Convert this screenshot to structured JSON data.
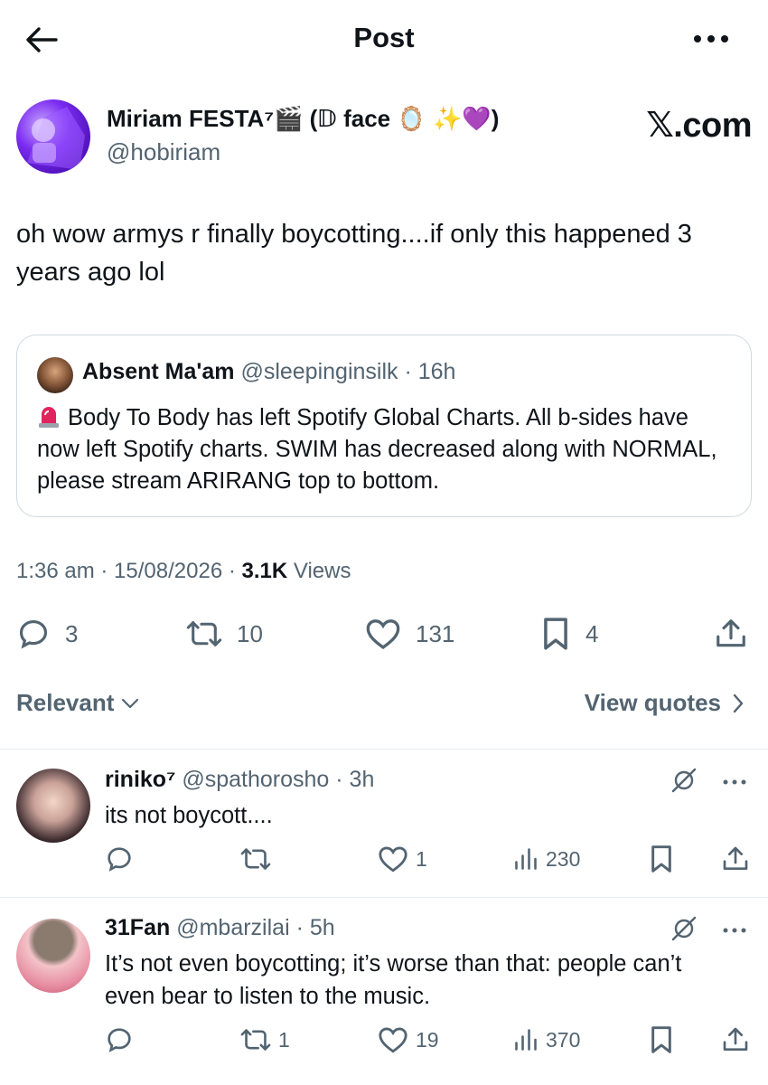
{
  "header": {
    "title": "Post"
  },
  "post": {
    "author_name": "Miriam FESTA⁷🎬 (𝔻 face 🪞 ✨💜)",
    "author_handle": "@hobiriam",
    "brand": "𝕏.com",
    "text": "oh wow armys r finally boycotting....if only this happened 3 years ago lol",
    "quote": {
      "name": "Absent Ma'am",
      "handle": "@sleepinginsilk",
      "sep": " · ",
      "time": "16h",
      "text": "Body To Body has left Spotify Global Charts. All b-sides have now left Spotify charts. SWIM has decreased along with NORMAL, please stream ARIRANG top to bottom."
    },
    "time": "1:36 am · 15/08/2026 · ",
    "views_count": "3.1K",
    "views_label": " Views",
    "stats": {
      "replies": "3",
      "reposts": "10",
      "likes": "131",
      "bookmarks": "4"
    }
  },
  "filters": {
    "sort_label": "Relevant",
    "view_quotes_label": "View quotes"
  },
  "replies": [
    {
      "name": "riniko⁷",
      "handle": "@spathorosho",
      "sep": " · ",
      "time": "3h",
      "text": "its not boycott....",
      "reply_count": "",
      "repost_count": "",
      "like_count": "1",
      "view_count": "230"
    },
    {
      "name": "31Fan",
      "handle": "@mbarzilai",
      "sep": " · ",
      "time": "5h",
      "text": "It’s not even boycotting; it’s worse than that: people can’t even bear to listen to the music.",
      "reply_count": "",
      "repost_count": "1",
      "like_count": "19",
      "view_count": "370"
    }
  ],
  "colors": {
    "text_primary": "#0f1419",
    "text_secondary": "#536471",
    "border": "#cfd9de",
    "avatar_purple": "#7a2bf0"
  },
  "icons": [
    "back-arrow-icon",
    "more-horizontal-icon",
    "siren-icon",
    "reply-icon",
    "repost-icon",
    "like-icon",
    "bookmark-icon",
    "share-icon",
    "chevron-down-icon",
    "chevron-right-icon",
    "grok-icon",
    "views-icon"
  ]
}
